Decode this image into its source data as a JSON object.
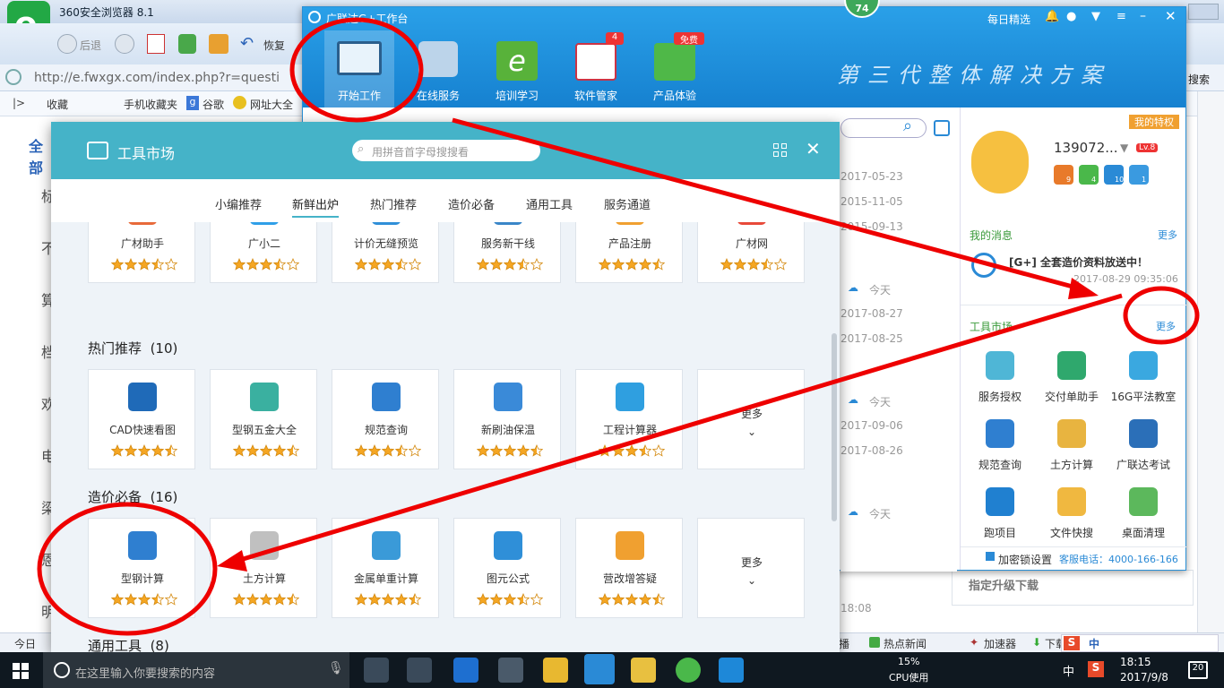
{
  "browser": {
    "title": "360安全浏览器 8.1",
    "back": "后退",
    "restore": "恢复",
    "url": "http://e.fwxgx.com/index.php?r=questi",
    "search": "搜索",
    "favorites": [
      "收藏",
      "手机收藏夹",
      "谷歌",
      "网址大全"
    ],
    "left_chars": [
      "全部",
      "标",
      "不",
      "算",
      "档",
      "欢",
      "电",
      "梁",
      "恩",
      "明"
    ],
    "status": [
      "今日",
      "播",
      "热点新闻",
      "加速器",
      "下载"
    ]
  },
  "gwin": {
    "title": "广联达G+工作台",
    "daily": "每日精选",
    "badge_74": "74",
    "nav": [
      {
        "label": "开始工作",
        "color": "#cfe7fa"
      },
      {
        "label": "在线服务",
        "color": "#bcd4ea"
      },
      {
        "label": "培训学习",
        "color": "#58b23a"
      },
      {
        "label": "软件管家",
        "color": "#ffffff",
        "badge": "4"
      },
      {
        "label": "产品体验",
        "color": "#4fb848",
        "badge": "免费"
      }
    ],
    "slogan": "第三代整体解决方案",
    "dates": [
      "2017-05-23",
      "2015-11-05",
      "2015-09-13",
      "今天",
      "2017-08-27",
      "2017-08-25",
      "今天",
      "2017-09-06",
      "2017-08-26",
      "今天",
      "18:08"
    ],
    "privilege": "我的特权",
    "user": "139072...",
    "level": "Lv.8",
    "user_badges": [
      "9",
      "4",
      "10",
      "1"
    ],
    "msg_title": "我的消息",
    "more": "更多",
    "msg_text": "[G+] 全套造价资料放送中！",
    "msg_time": "2017-08-29 09:35:06",
    "tools_title": "工具市场",
    "tools_more": "更多",
    "tools": [
      {
        "label": "服务授权",
        "color": "#4fb6d6"
      },
      {
        "label": "交付单助手",
        "color": "#2fa86d"
      },
      {
        "label": "16G平法教室",
        "color": "#3aa8e0"
      },
      {
        "label": "规范查询",
        "color": "#2f7fd0"
      },
      {
        "label": "土方计算",
        "color": "#e8b440"
      },
      {
        "label": "广联达考试",
        "color": "#2b6fb8"
      },
      {
        "label": "跑项目",
        "color": "#2080d0"
      },
      {
        "label": "文件快搜",
        "color": "#f0b840"
      },
      {
        "label": "桌面清理",
        "color": "#5cb85c"
      }
    ],
    "lock": "加密锁设置",
    "hotline": "客服电话：4000-166-166",
    "upgrade": "指定升级下载"
  },
  "market": {
    "title": "工具市场",
    "search_placeholder": "用拼音首字母搜搜看",
    "tabs": [
      "小编推荐",
      "新鲜出炉",
      "热门推荐",
      "造价必备",
      "通用工具",
      "服务通道"
    ],
    "row1": [
      {
        "label": "广材助手",
        "rating": 3.5,
        "color": "#e86a3a"
      },
      {
        "label": "广小二",
        "rating": 3.5,
        "color": "#2f9fe8"
      },
      {
        "label": "计价无缝预览",
        "rating": 3.5,
        "color": "#2f8fd8"
      },
      {
        "label": "服务新干线",
        "rating": 3.5,
        "color": "#3a86c8"
      },
      {
        "label": "产品注册",
        "rating": 4.5,
        "color": "#f0a030"
      },
      {
        "label": "广材网",
        "rating": 3.5,
        "color": "#e84a3a"
      }
    ],
    "sec_hot": "热门推荐",
    "sec_hot_count": "(10)",
    "row2": [
      {
        "label": "CAD快速看图",
        "rating": 4.5,
        "color": "#1f6ab8"
      },
      {
        "label": "型钢五金大全",
        "rating": 4.5,
        "color": "#3ab0a0"
      },
      {
        "label": "规范查询",
        "rating": 3.5,
        "color": "#2f7fd0"
      },
      {
        "label": "新刷油保温",
        "rating": 4.5,
        "color": "#3a8ad8"
      },
      {
        "label": "工程计算器",
        "rating": 3.5,
        "color": "#2f9fe0"
      }
    ],
    "sec_cost": "造价必备",
    "sec_cost_count": "(16)",
    "row3": [
      {
        "label": "型钢计算",
        "rating": 3.5,
        "color": "#2f7fd0"
      },
      {
        "label": "土方计算",
        "rating": 4.5,
        "color": "#c0c0c0"
      },
      {
        "label": "金属单重计算",
        "rating": 4.5,
        "color": "#3a9ad8"
      },
      {
        "label": "图元公式",
        "rating": 3.5,
        "color": "#2f8fd8"
      },
      {
        "label": "营改增答疑",
        "rating": 4.5,
        "color": "#f0a030"
      }
    ],
    "more": "更多",
    "sec_general": "通用工具",
    "sec_general_count": "(8)"
  },
  "taskbar": {
    "search_placeholder": "在这里输入你要搜索的内容",
    "cpu": "15%",
    "cpu_label": "CPU使用",
    "ime": "中",
    "time": "18:15",
    "date": "2017/9/8",
    "notif": "20"
  }
}
